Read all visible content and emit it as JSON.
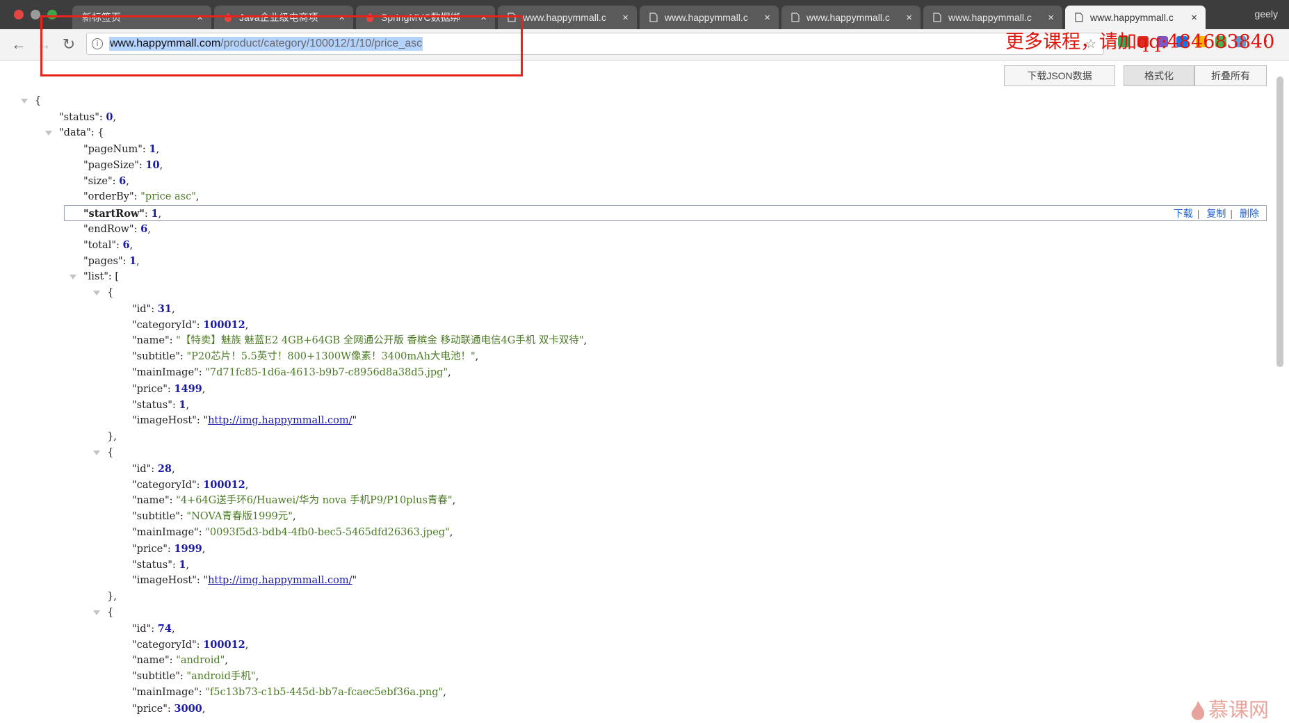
{
  "tabs": [
    {
      "label": "新标签页",
      "icon": "none",
      "active": false
    },
    {
      "label": "Java企业级电商项",
      "icon": "flame-icon",
      "active": false
    },
    {
      "label": "SpringMVC数据绑",
      "icon": "flame-icon",
      "active": false
    },
    {
      "label": "www.happymmall.c",
      "icon": "page-icon",
      "active": false
    },
    {
      "label": "www.happymmall.c",
      "icon": "page-icon",
      "active": false
    },
    {
      "label": "www.happymmall.c",
      "icon": "page-icon",
      "active": false
    },
    {
      "label": "www.happymmall.c",
      "icon": "page-icon",
      "active": false
    },
    {
      "label": "www.happymmall.c",
      "icon": "page-icon",
      "active": true
    }
  ],
  "profile_name": "geely",
  "address": {
    "host": "www.happymmall.com",
    "path": "/product/category/100012/1/10/price_asc"
  },
  "promo_text": "更多课程，请加qq:484683840",
  "viewer": {
    "download_json": "下载JSON数据",
    "format": "格式化",
    "collapse_all": "折叠所有"
  },
  "row_actions": {
    "download": "下载",
    "copy": "复制",
    "delete": "删除"
  },
  "json": {
    "status": "0",
    "pageNum": "1",
    "pageSize": "10",
    "size": "6",
    "orderBy": "\"price asc\"",
    "startRow": "1",
    "endRow": "6",
    "total": "6",
    "pages": "1",
    "list": [
      {
        "id": "31",
        "categoryId": "100012",
        "name": "\"【特卖】魅族 魅蓝E2 4GB+64GB 全网通公开版 香槟金 移动联通电信4G手机 双卡双待\"",
        "subtitle": "\"P20芯片！5.5英寸！800+1300W像素！3400mAh大电池！\"",
        "mainImage": "\"7d71fc85-1d6a-4613-b9b7-c8956d8a38d5.jpg\"",
        "price": "1499",
        "status": "1",
        "imageHost": "http://img.happymmall.com/"
      },
      {
        "id": "28",
        "categoryId": "100012",
        "name": "\"4+64G送手环6/Huawei/华为 nova 手机P9/P10plus青春\"",
        "subtitle": "\"NOVA青春版1999元\"",
        "mainImage": "\"0093f5d3-bdb4-4fb0-bec5-5465dfd26363.jpeg\"",
        "price": "1999",
        "status": "1",
        "imageHost": "http://img.happymmall.com/"
      },
      {
        "id": "74",
        "categoryId": "100012",
        "name": "\"android\"",
        "subtitle": "\"android手机\"",
        "mainImage": "\"f5c13b73-c1b5-445d-bb7a-fcaec5ebf36a.png\"",
        "price": "3000"
      }
    ]
  },
  "watermark": "慕课网"
}
